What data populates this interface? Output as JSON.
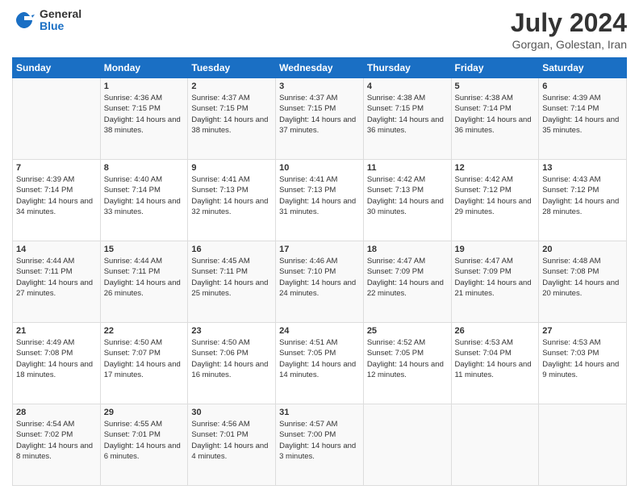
{
  "logo": {
    "general": "General",
    "blue": "Blue"
  },
  "header": {
    "title": "July 2024",
    "subtitle": "Gorgan, Golestan, Iran"
  },
  "days_of_week": [
    "Sunday",
    "Monday",
    "Tuesday",
    "Wednesday",
    "Thursday",
    "Friday",
    "Saturday"
  ],
  "weeks": [
    [
      {
        "day": "",
        "sunrise": "",
        "sunset": "",
        "daylight": ""
      },
      {
        "day": "1",
        "sunrise": "Sunrise: 4:36 AM",
        "sunset": "Sunset: 7:15 PM",
        "daylight": "Daylight: 14 hours and 38 minutes."
      },
      {
        "day": "2",
        "sunrise": "Sunrise: 4:37 AM",
        "sunset": "Sunset: 7:15 PM",
        "daylight": "Daylight: 14 hours and 38 minutes."
      },
      {
        "day": "3",
        "sunrise": "Sunrise: 4:37 AM",
        "sunset": "Sunset: 7:15 PM",
        "daylight": "Daylight: 14 hours and 37 minutes."
      },
      {
        "day": "4",
        "sunrise": "Sunrise: 4:38 AM",
        "sunset": "Sunset: 7:15 PM",
        "daylight": "Daylight: 14 hours and 36 minutes."
      },
      {
        "day": "5",
        "sunrise": "Sunrise: 4:38 AM",
        "sunset": "Sunset: 7:14 PM",
        "daylight": "Daylight: 14 hours and 36 minutes."
      },
      {
        "day": "6",
        "sunrise": "Sunrise: 4:39 AM",
        "sunset": "Sunset: 7:14 PM",
        "daylight": "Daylight: 14 hours and 35 minutes."
      }
    ],
    [
      {
        "day": "7",
        "sunrise": "Sunrise: 4:39 AM",
        "sunset": "Sunset: 7:14 PM",
        "daylight": "Daylight: 14 hours and 34 minutes."
      },
      {
        "day": "8",
        "sunrise": "Sunrise: 4:40 AM",
        "sunset": "Sunset: 7:14 PM",
        "daylight": "Daylight: 14 hours and 33 minutes."
      },
      {
        "day": "9",
        "sunrise": "Sunrise: 4:41 AM",
        "sunset": "Sunset: 7:13 PM",
        "daylight": "Daylight: 14 hours and 32 minutes."
      },
      {
        "day": "10",
        "sunrise": "Sunrise: 4:41 AM",
        "sunset": "Sunset: 7:13 PM",
        "daylight": "Daylight: 14 hours and 31 minutes."
      },
      {
        "day": "11",
        "sunrise": "Sunrise: 4:42 AM",
        "sunset": "Sunset: 7:13 PM",
        "daylight": "Daylight: 14 hours and 30 minutes."
      },
      {
        "day": "12",
        "sunrise": "Sunrise: 4:42 AM",
        "sunset": "Sunset: 7:12 PM",
        "daylight": "Daylight: 14 hours and 29 minutes."
      },
      {
        "day": "13",
        "sunrise": "Sunrise: 4:43 AM",
        "sunset": "Sunset: 7:12 PM",
        "daylight": "Daylight: 14 hours and 28 minutes."
      }
    ],
    [
      {
        "day": "14",
        "sunrise": "Sunrise: 4:44 AM",
        "sunset": "Sunset: 7:11 PM",
        "daylight": "Daylight: 14 hours and 27 minutes."
      },
      {
        "day": "15",
        "sunrise": "Sunrise: 4:44 AM",
        "sunset": "Sunset: 7:11 PM",
        "daylight": "Daylight: 14 hours and 26 minutes."
      },
      {
        "day": "16",
        "sunrise": "Sunrise: 4:45 AM",
        "sunset": "Sunset: 7:11 PM",
        "daylight": "Daylight: 14 hours and 25 minutes."
      },
      {
        "day": "17",
        "sunrise": "Sunrise: 4:46 AM",
        "sunset": "Sunset: 7:10 PM",
        "daylight": "Daylight: 14 hours and 24 minutes."
      },
      {
        "day": "18",
        "sunrise": "Sunrise: 4:47 AM",
        "sunset": "Sunset: 7:09 PM",
        "daylight": "Daylight: 14 hours and 22 minutes."
      },
      {
        "day": "19",
        "sunrise": "Sunrise: 4:47 AM",
        "sunset": "Sunset: 7:09 PM",
        "daylight": "Daylight: 14 hours and 21 minutes."
      },
      {
        "day": "20",
        "sunrise": "Sunrise: 4:48 AM",
        "sunset": "Sunset: 7:08 PM",
        "daylight": "Daylight: 14 hours and 20 minutes."
      }
    ],
    [
      {
        "day": "21",
        "sunrise": "Sunrise: 4:49 AM",
        "sunset": "Sunset: 7:08 PM",
        "daylight": "Daylight: 14 hours and 18 minutes."
      },
      {
        "day": "22",
        "sunrise": "Sunrise: 4:50 AM",
        "sunset": "Sunset: 7:07 PM",
        "daylight": "Daylight: 14 hours and 17 minutes."
      },
      {
        "day": "23",
        "sunrise": "Sunrise: 4:50 AM",
        "sunset": "Sunset: 7:06 PM",
        "daylight": "Daylight: 14 hours and 16 minutes."
      },
      {
        "day": "24",
        "sunrise": "Sunrise: 4:51 AM",
        "sunset": "Sunset: 7:05 PM",
        "daylight": "Daylight: 14 hours and 14 minutes."
      },
      {
        "day": "25",
        "sunrise": "Sunrise: 4:52 AM",
        "sunset": "Sunset: 7:05 PM",
        "daylight": "Daylight: 14 hours and 12 minutes."
      },
      {
        "day": "26",
        "sunrise": "Sunrise: 4:53 AM",
        "sunset": "Sunset: 7:04 PM",
        "daylight": "Daylight: 14 hours and 11 minutes."
      },
      {
        "day": "27",
        "sunrise": "Sunrise: 4:53 AM",
        "sunset": "Sunset: 7:03 PM",
        "daylight": "Daylight: 14 hours and 9 minutes."
      }
    ],
    [
      {
        "day": "28",
        "sunrise": "Sunrise: 4:54 AM",
        "sunset": "Sunset: 7:02 PM",
        "daylight": "Daylight: 14 hours and 8 minutes."
      },
      {
        "day": "29",
        "sunrise": "Sunrise: 4:55 AM",
        "sunset": "Sunset: 7:01 PM",
        "daylight": "Daylight: 14 hours and 6 minutes."
      },
      {
        "day": "30",
        "sunrise": "Sunrise: 4:56 AM",
        "sunset": "Sunset: 7:01 PM",
        "daylight": "Daylight: 14 hours and 4 minutes."
      },
      {
        "day": "31",
        "sunrise": "Sunrise: 4:57 AM",
        "sunset": "Sunset: 7:00 PM",
        "daylight": "Daylight: 14 hours and 3 minutes."
      },
      {
        "day": "",
        "sunrise": "",
        "sunset": "",
        "daylight": ""
      },
      {
        "day": "",
        "sunrise": "",
        "sunset": "",
        "daylight": ""
      },
      {
        "day": "",
        "sunrise": "",
        "sunset": "",
        "daylight": ""
      }
    ]
  ]
}
